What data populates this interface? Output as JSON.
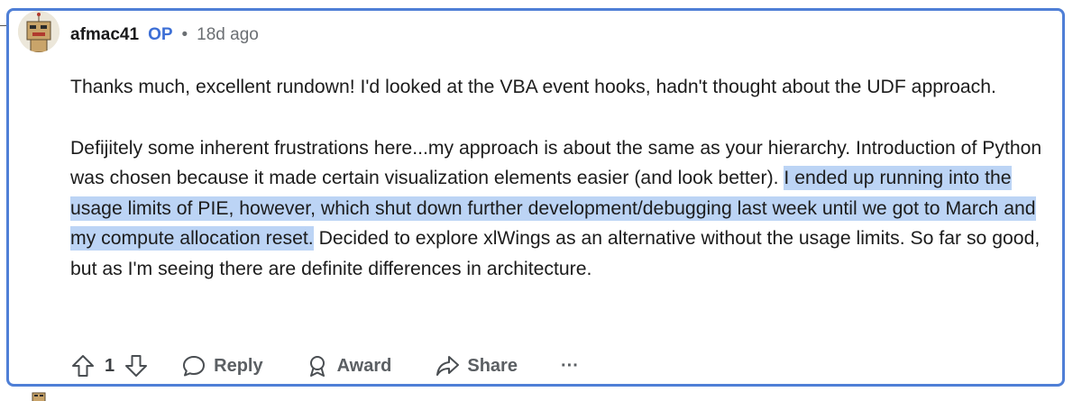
{
  "comment": {
    "author": "afmac41",
    "op_badge": "OP",
    "separator": "•",
    "time_ago": "18d ago",
    "paragraph1": "Thanks much, excellent rundown! I'd looked at the VBA event hooks, hadn't thought about the UDF approach.",
    "paragraph2": {
      "before": "Defijitely some inherent frustrations here...my approach is about the same as your hierarchy. Introduction of Python was chosen because it made certain visualization elements easier (and look better). ",
      "highlighted": "I ended up running into the usage limits of PIE, however, which shut down further development/debugging last week until we got to March and my compute allocation reset.",
      "after": " Decided to explore xlWings as an alternative without the usage limits. So far so good, but as I'm seeing there are definite differences in architecture."
    }
  },
  "actions": {
    "vote_count": "1",
    "reply_label": "Reply",
    "award_label": "Award",
    "share_label": "Share",
    "more_label": "···"
  },
  "colors": {
    "accent_border": "#4f7fd6",
    "op_badge": "#3d6fd6",
    "highlight": "#bcd4f5",
    "muted_text": "#6b6f73"
  }
}
